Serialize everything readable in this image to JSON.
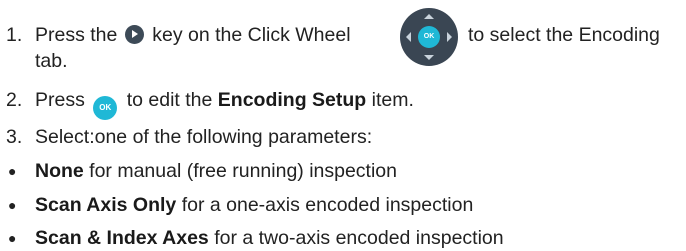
{
  "steps": [
    {
      "number": "1.",
      "text_a": "Press the",
      "text_b": "key on the Click Wheel",
      "text_c": "to select the Encoding",
      "text_wrap": "tab."
    },
    {
      "number": "2.",
      "text_a": "Press",
      "text_b": "to edit the",
      "bold": "Encoding Setup",
      "text_c": "item."
    },
    {
      "number": "3.",
      "text": "Select:one of the following parameters:"
    }
  ],
  "keys": {
    "ok_label": "OK",
    "wheel_center_label": "OK"
  },
  "options": [
    {
      "bold": "None",
      "text": "for manual (free running) inspection"
    },
    {
      "bold": "Scan Axis Only",
      "text": "for a one-axis encoded inspection"
    },
    {
      "bold": "Scan & Index Axes",
      "text": "for a two-axis encoded inspection"
    }
  ],
  "colors": {
    "key_dark": "#3d4a57",
    "key_accent": "#1fb8d6"
  }
}
